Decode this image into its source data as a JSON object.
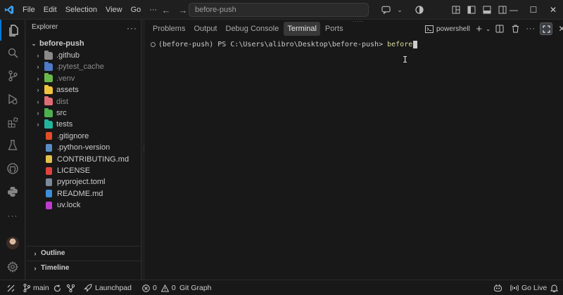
{
  "titlebar": {
    "menu": [
      "File",
      "Edit",
      "Selection",
      "View",
      "Go"
    ],
    "more": "···",
    "search_text": "before-push"
  },
  "explorer": {
    "title": "Explorer",
    "more": "···",
    "root": "before-push",
    "items": [
      {
        "label": ".github",
        "kind": "folder",
        "color": "#8a8a8a",
        "dim": false
      },
      {
        "label": ".pytest_cache",
        "kind": "folder",
        "color": "#4e7ac7",
        "dim": true
      },
      {
        "label": ".venv",
        "kind": "folder",
        "color": "#6bb84a",
        "dim": true
      },
      {
        "label": "assets",
        "kind": "folder",
        "color": "#f0c33c",
        "dim": false
      },
      {
        "label": "dist",
        "kind": "folder",
        "color": "#e06c75",
        "dim": true
      },
      {
        "label": "src",
        "kind": "folder",
        "color": "#4caf50",
        "dim": false
      },
      {
        "label": "tests",
        "kind": "folder",
        "color": "#22b59e",
        "dim": false
      },
      {
        "label": ".gitignore",
        "kind": "file",
        "color": "#e44d26",
        "dim": false
      },
      {
        "label": ".python-version",
        "kind": "file",
        "color": "#5a8cc4",
        "dim": false
      },
      {
        "label": "CONTRIBUTING.md",
        "kind": "file",
        "color": "#e2c04a",
        "dim": false
      },
      {
        "label": "LICENSE",
        "kind": "file",
        "color": "#e0433c",
        "dim": false
      },
      {
        "label": "pyproject.toml",
        "kind": "file",
        "color": "#7a8a9a",
        "dim": false
      },
      {
        "label": "README.md",
        "kind": "file",
        "color": "#3c8fd8",
        "dim": false
      },
      {
        "label": "uv.lock",
        "kind": "file",
        "color": "#c03ad0",
        "dim": false
      }
    ],
    "outline": "Outline",
    "timeline": "Timeline"
  },
  "panel": {
    "tabs": [
      "Problems",
      "Output",
      "Debug Console",
      "Terminal",
      "Ports"
    ],
    "active_tab": "Terminal",
    "shell": "powershell",
    "terminal": {
      "prompt": "(before-push) PS C:\\Users\\alibro\\Desktop\\before-push> ",
      "input": "before"
    }
  },
  "statusbar": {
    "branch": "main",
    "launchpad": "Launchpad",
    "errors": "0",
    "warnings": "0",
    "gitgraph": "Git Graph",
    "golive": "Go Live"
  },
  "colors": {
    "accent": "#0078d4",
    "command": "#dcdc9d"
  }
}
